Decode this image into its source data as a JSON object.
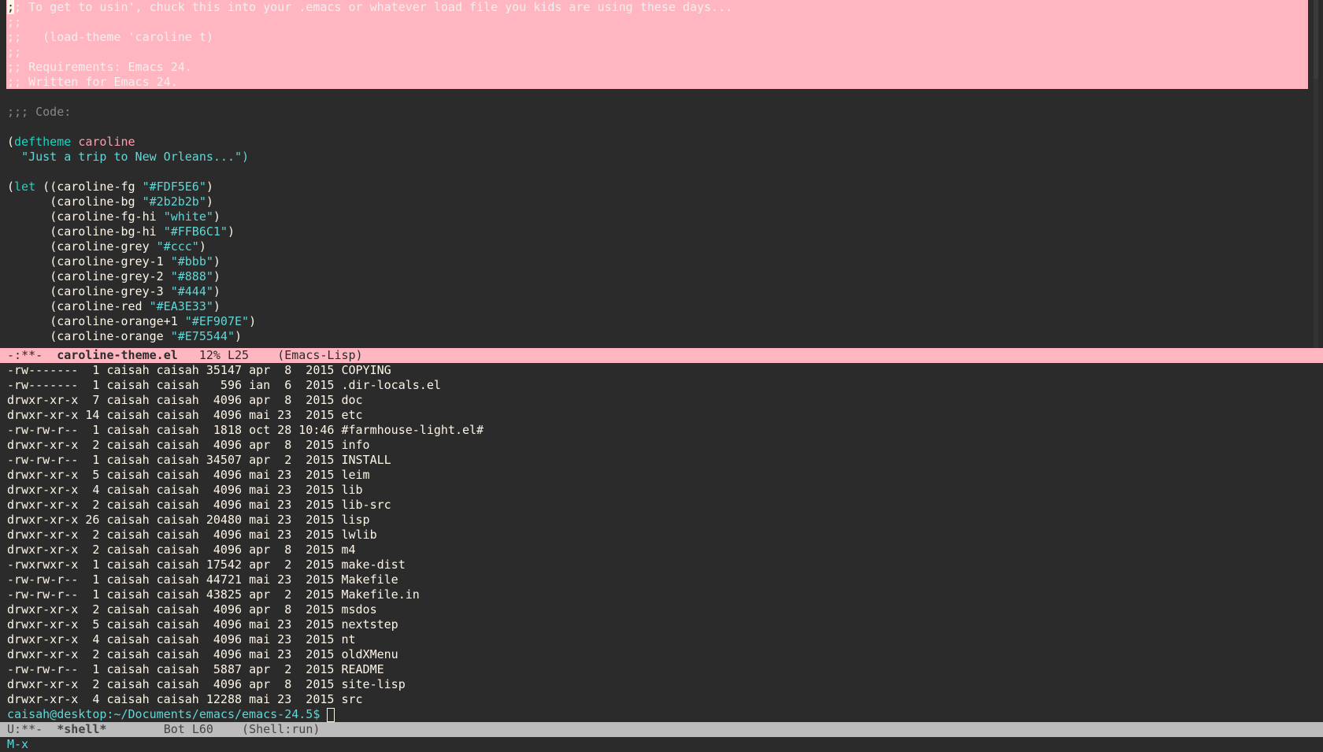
{
  "editor": {
    "header_comment": [
      ";; To get to usin', chuck this into your .emacs or whatever load file you kids are using these days...",
      ";;",
      ";;   (load-theme 'caroline t)",
      ";;",
      ";; Requirements: Emacs 24.",
      ";; Written for Emacs 24."
    ],
    "code_comment": ";;; Code:",
    "deftheme": {
      "open": "(",
      "keyword": "deftheme",
      "name": "caroline"
    },
    "docstring": "\"Just a trip to New Orleans...\")",
    "let": {
      "open": "(",
      "keyword": "let",
      "rest": " ("
    },
    "bindings": [
      {
        "name": "(caroline-fg ",
        "value": "\"#FDF5E6\"",
        "close": ")"
      },
      {
        "name": "(caroline-bg ",
        "value": "\"#2b2b2b\"",
        "close": ")"
      },
      {
        "name": "(caroline-fg-hi ",
        "value": "\"white\"",
        "close": ")"
      },
      {
        "name": "(caroline-bg-hi ",
        "value": "\"#FFB6C1\"",
        "close": ")"
      },
      {
        "name": "(caroline-grey ",
        "value": "\"#ccc\"",
        "close": ")"
      },
      {
        "name": "(caroline-grey-1 ",
        "value": "\"#bbb\"",
        "close": ")"
      },
      {
        "name": "(caroline-grey-2 ",
        "value": "\"#888\"",
        "close": ")"
      },
      {
        "name": "(caroline-grey-3 ",
        "value": "\"#444\"",
        "close": ")"
      },
      {
        "name": "(caroline-red ",
        "value": "\"#EA3E33\"",
        "close": ")"
      },
      {
        "name": "(caroline-orange+1 ",
        "value": "\"#EF907E\"",
        "close": ")"
      },
      {
        "name": "(caroline-orange ",
        "value": "\"#E75544\"",
        "close": ")"
      }
    ]
  },
  "modeline_top": {
    "status": " -:**-  ",
    "buffer": "caroline-theme.el",
    "position": "   12% L25",
    "mode": "    (Emacs-Lisp)"
  },
  "shell": {
    "listing": [
      {
        "perms": "-rw-------",
        "links": " 1",
        "owner": "caisah",
        "group": "caisah",
        "size": "35147",
        "date": "apr  8  2015",
        "name": "COPYING"
      },
      {
        "perms": "-rw-------",
        "links": " 1",
        "owner": "caisah",
        "group": "caisah",
        "size": "  596",
        "date": "ian  6  2015",
        "name": ".dir-locals.el"
      },
      {
        "perms": "drwxr-xr-x",
        "links": " 7",
        "owner": "caisah",
        "group": "caisah",
        "size": " 4096",
        "date": "apr  8  2015",
        "name": "doc"
      },
      {
        "perms": "drwxr-xr-x",
        "links": "14",
        "owner": "caisah",
        "group": "caisah",
        "size": " 4096",
        "date": "mai 23  2015",
        "name": "etc"
      },
      {
        "perms": "-rw-rw-r--",
        "links": " 1",
        "owner": "caisah",
        "group": "caisah",
        "size": " 1818",
        "date": "oct 28 10:46",
        "name": "#farmhouse-light.el#"
      },
      {
        "perms": "drwxr-xr-x",
        "links": " 2",
        "owner": "caisah",
        "group": "caisah",
        "size": " 4096",
        "date": "apr  8  2015",
        "name": "info"
      },
      {
        "perms": "-rw-rw-r--",
        "links": " 1",
        "owner": "caisah",
        "group": "caisah",
        "size": "34507",
        "date": "apr  2  2015",
        "name": "INSTALL"
      },
      {
        "perms": "drwxr-xr-x",
        "links": " 5",
        "owner": "caisah",
        "group": "caisah",
        "size": " 4096",
        "date": "mai 23  2015",
        "name": "leim"
      },
      {
        "perms": "drwxr-xr-x",
        "links": " 4",
        "owner": "caisah",
        "group": "caisah",
        "size": " 4096",
        "date": "mai 23  2015",
        "name": "lib"
      },
      {
        "perms": "drwxr-xr-x",
        "links": " 2",
        "owner": "caisah",
        "group": "caisah",
        "size": " 4096",
        "date": "mai 23  2015",
        "name": "lib-src"
      },
      {
        "perms": "drwxr-xr-x",
        "links": "26",
        "owner": "caisah",
        "group": "caisah",
        "size": "20480",
        "date": "mai 23  2015",
        "name": "lisp"
      },
      {
        "perms": "drwxr-xr-x",
        "links": " 2",
        "owner": "caisah",
        "group": "caisah",
        "size": " 4096",
        "date": "mai 23  2015",
        "name": "lwlib"
      },
      {
        "perms": "drwxr-xr-x",
        "links": " 2",
        "owner": "caisah",
        "group": "caisah",
        "size": " 4096",
        "date": "apr  8  2015",
        "name": "m4"
      },
      {
        "perms": "-rwxrwxr-x",
        "links": " 1",
        "owner": "caisah",
        "group": "caisah",
        "size": "17542",
        "date": "apr  2  2015",
        "name": "make-dist"
      },
      {
        "perms": "-rw-rw-r--",
        "links": " 1",
        "owner": "caisah",
        "group": "caisah",
        "size": "44721",
        "date": "mai 23  2015",
        "name": "Makefile"
      },
      {
        "perms": "-rw-rw-r--",
        "links": " 1",
        "owner": "caisah",
        "group": "caisah",
        "size": "43825",
        "date": "apr  2  2015",
        "name": "Makefile.in"
      },
      {
        "perms": "drwxr-xr-x",
        "links": " 2",
        "owner": "caisah",
        "group": "caisah",
        "size": " 4096",
        "date": "apr  8  2015",
        "name": "msdos"
      },
      {
        "perms": "drwxr-xr-x",
        "links": " 5",
        "owner": "caisah",
        "group": "caisah",
        "size": " 4096",
        "date": "mai 23  2015",
        "name": "nextstep"
      },
      {
        "perms": "drwxr-xr-x",
        "links": " 4",
        "owner": "caisah",
        "group": "caisah",
        "size": " 4096",
        "date": "mai 23  2015",
        "name": "nt"
      },
      {
        "perms": "drwxr-xr-x",
        "links": " 2",
        "owner": "caisah",
        "group": "caisah",
        "size": " 4096",
        "date": "mai 23  2015",
        "name": "oldXMenu"
      },
      {
        "perms": "-rw-rw-r--",
        "links": " 1",
        "owner": "caisah",
        "group": "caisah",
        "size": " 5887",
        "date": "apr  2  2015",
        "name": "README"
      },
      {
        "perms": "drwxr-xr-x",
        "links": " 2",
        "owner": "caisah",
        "group": "caisah",
        "size": " 4096",
        "date": "apr  8  2015",
        "name": "site-lisp"
      },
      {
        "perms": "drwxr-xr-x",
        "links": " 4",
        "owner": "caisah",
        "group": "caisah",
        "size": "12288",
        "date": "mai 23  2015",
        "name": "src"
      }
    ],
    "prompt": "caisah@desktop:~/Documents/emacs/emacs-24.5$ "
  },
  "modeline_bottom": {
    "status": " U:**-  ",
    "buffer": "*shell*",
    "position": "        Bot L60",
    "mode": "    (Shell:run)"
  },
  "minibuffer": {
    "text": "M-x"
  },
  "colors": {
    "fg": "#FDF5E6",
    "bg": "#2b2b2b",
    "bg_hi": "#FFB6C1",
    "keyword": "#1dd3c1",
    "string": "#5fd7d7",
    "function_name": "#ff9eb0",
    "modeline_inactive": "#bcbcbc"
  }
}
